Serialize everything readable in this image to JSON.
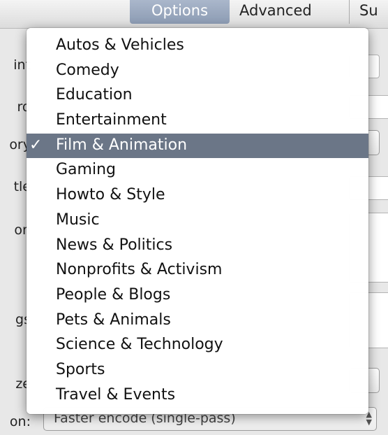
{
  "tabs": [
    {
      "label": "Options",
      "selected": true
    },
    {
      "label": "Advanced",
      "selected": false
    },
    {
      "label": "Su",
      "selected": false
    }
  ],
  "background": {
    "labels": [
      "int",
      "rd",
      "ory",
      "tle",
      "on",
      "gs",
      "ze",
      "on:"
    ],
    "encode_popup_value": "Faster encode (single-pass)"
  },
  "menu": {
    "items": [
      {
        "label": "Autos & Vehicles",
        "selected": false
      },
      {
        "label": "Comedy",
        "selected": false
      },
      {
        "label": "Education",
        "selected": false
      },
      {
        "label": "Entertainment",
        "selected": false
      },
      {
        "label": "Film & Animation",
        "selected": true
      },
      {
        "label": "Gaming",
        "selected": false
      },
      {
        "label": "Howto & Style",
        "selected": false
      },
      {
        "label": "Music",
        "selected": false
      },
      {
        "label": "News & Politics",
        "selected": false
      },
      {
        "label": "Nonprofits & Activism",
        "selected": false
      },
      {
        "label": "People & Blogs",
        "selected": false
      },
      {
        "label": "Pets & Animals",
        "selected": false
      },
      {
        "label": "Science & Technology",
        "selected": false
      },
      {
        "label": "Sports",
        "selected": false
      },
      {
        "label": "Travel & Events",
        "selected": false
      }
    ],
    "checkmark": "✓"
  },
  "colors": {
    "selection": "#6b7687",
    "tab_selected": "#9aa8be",
    "focus_blue": "#4a7bc5"
  }
}
